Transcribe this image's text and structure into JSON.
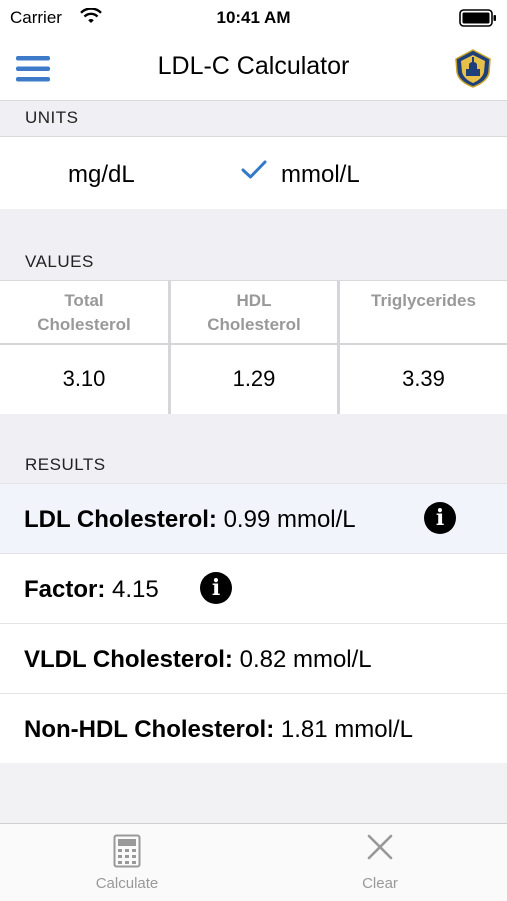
{
  "status_bar": {
    "carrier": "Carrier",
    "time": "10:41 AM"
  },
  "nav": {
    "title": "LDL-C Calculator",
    "menu_icon": "hamburger-menu-icon",
    "logo_icon": "johns-hopkins-shield-logo"
  },
  "units": {
    "header": "UNITS",
    "options": [
      "mg/dL",
      "mmol/L"
    ],
    "selected": "mmol/L",
    "check_color": "#3478c8"
  },
  "values": {
    "header": "VALUES",
    "columns": [
      {
        "label_line1": "Total",
        "label_line2": "Cholesterol",
        "value": "3.10"
      },
      {
        "label_line1": "HDL",
        "label_line2": "Cholesterol",
        "value": "1.29"
      },
      {
        "label_line1": "Triglycerides",
        "label_line2": "",
        "value": "3.39"
      }
    ]
  },
  "results": {
    "header": "RESULTS",
    "rows": [
      {
        "label": "LDL Cholesterol:",
        "value": "0.99 mmol/L",
        "info": true,
        "highlight": true
      },
      {
        "label": "Factor:",
        "value": "4.15",
        "info": true,
        "highlight": false
      },
      {
        "label": "VLDL Cholesterol:",
        "value": "0.82 mmol/L",
        "info": false,
        "highlight": false
      },
      {
        "label": "Non-HDL Cholesterol:",
        "value": "1.81 mmol/L",
        "info": false,
        "highlight": false
      }
    ],
    "highlight_color": "#f1f4fb"
  },
  "tab_bar": {
    "tabs": [
      {
        "label": "Calculate",
        "icon": "calculator-icon"
      },
      {
        "label": "Clear",
        "icon": "close-icon"
      }
    ]
  },
  "colors": {
    "accent": "#3d7bc9",
    "muted": "#999999",
    "section_bg": "#efeff4"
  }
}
